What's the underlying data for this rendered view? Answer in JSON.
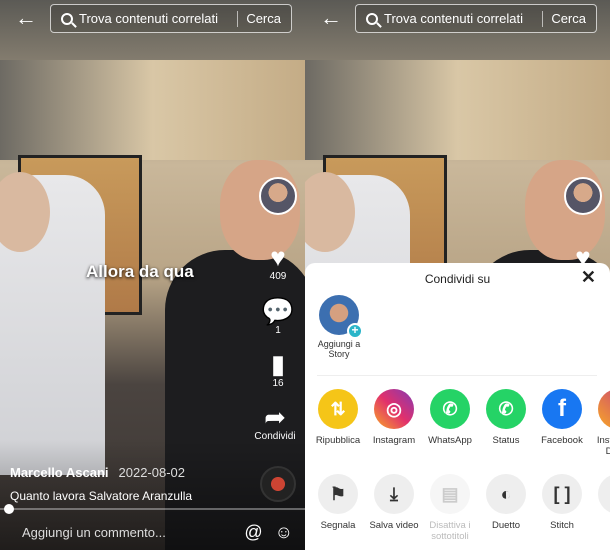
{
  "header": {
    "back_icon": "arrow-left-icon",
    "search_text": "Trova contenuti correlati",
    "search_button": "Cerca"
  },
  "video": {
    "overlay_text": "Allora da qua",
    "author": "Marcello Ascani",
    "date": "2022-08-02",
    "description": "Quanto lavora Salvatore Aranzulla",
    "progress_percent": 3
  },
  "actions": {
    "likes": "409",
    "comments": "1",
    "saves": "16",
    "share": "Condividi"
  },
  "comment_bar": {
    "placeholder": "Aggiungi un commento..."
  },
  "share_sheet": {
    "title": "Condividi su",
    "story_label": "Aggiungi a Story",
    "apps": [
      {
        "label": "Ripubblica",
        "color": "#f5c518",
        "icon": "repost-icon"
      },
      {
        "label": "Instagram",
        "color": "#d6336c",
        "icon": "instagram-icon"
      },
      {
        "label": "WhatsApp",
        "color": "#25d366",
        "icon": "whatsapp-icon"
      },
      {
        "label": "Status",
        "color": "#25d366",
        "icon": "whatsapp-status-icon"
      },
      {
        "label": "Facebook",
        "color": "#1877f2",
        "icon": "facebook-icon"
      },
      {
        "label": "Instagram Direct",
        "color": "#c13584",
        "icon": "instagram-direct-icon"
      }
    ],
    "actions": [
      {
        "label": "Segnala",
        "icon": "flag-icon"
      },
      {
        "label": "Salva video",
        "icon": "download-icon"
      },
      {
        "label": "Disattiva i sottotitoli",
        "icon": "captions-off-icon"
      },
      {
        "label": "Duetto",
        "icon": "duet-icon"
      },
      {
        "label": "Stitch",
        "icon": "stitch-icon"
      }
    ]
  }
}
